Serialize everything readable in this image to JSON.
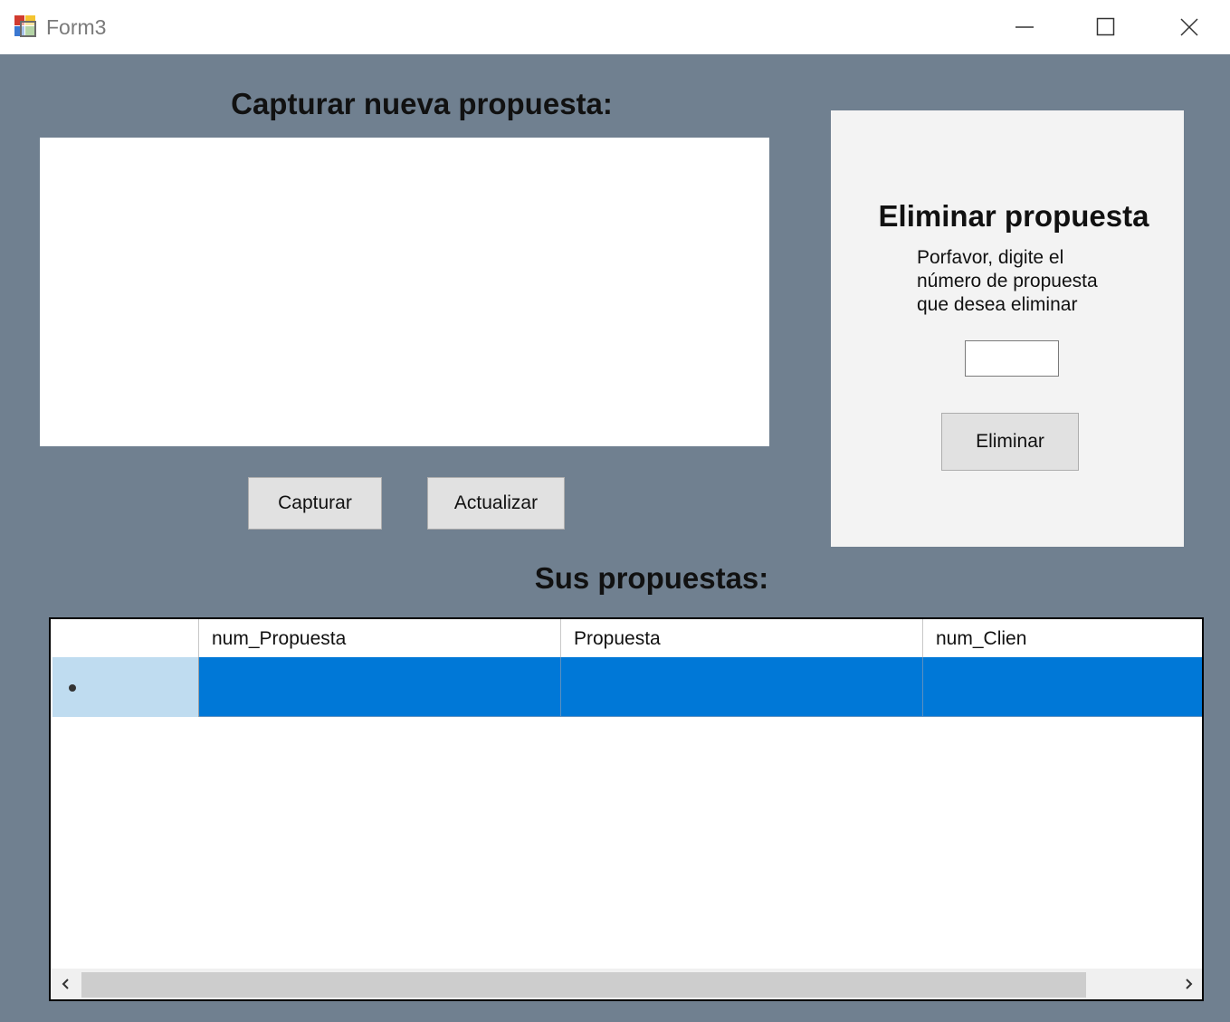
{
  "window": {
    "title": "Form3"
  },
  "capture": {
    "heading": "Capturar nueva propuesta:",
    "text_value": "",
    "capture_button": "Capturar",
    "update_button": "Actualizar"
  },
  "delete": {
    "heading": "Eliminar propuesta",
    "description_line1": "Porfavor, digite el",
    "description_line2": "número de propuesta",
    "description_line3": "que desea eliminar",
    "input_value": "",
    "button": "Eliminar"
  },
  "list": {
    "heading": "Sus propuestas:",
    "columns": [
      "num_Propuesta",
      "Propuesta",
      "num_Clien"
    ],
    "rows": [
      [
        "",
        "",
        ""
      ]
    ],
    "selection_color": "#0078d7"
  },
  "colors": {
    "form_background": "#708090",
    "panel_background": "#f3f3f3"
  }
}
